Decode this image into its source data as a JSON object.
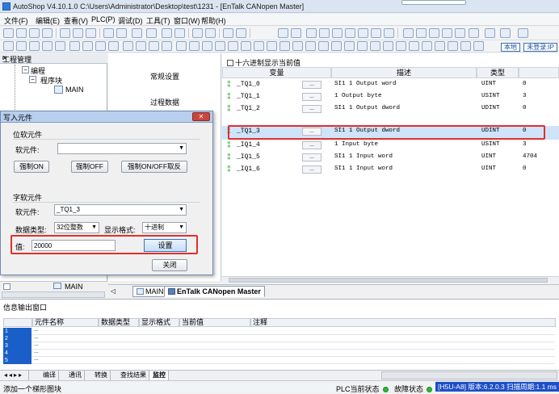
{
  "window": {
    "title": "AutoShop V4.10.1.0  C:\\Users\\Administrator\\Desktop\\test\\1231 - [EnTalk CANopen Master]"
  },
  "menu": [
    "文件(F)",
    "编辑(E)",
    "查看(V)",
    "PLC(P)",
    "调试(D)",
    "工具(T)",
    "窗口(W)",
    "帮助(H)"
  ],
  "toolbar": {
    "local_label": "本地",
    "login_label": "未登录:IP"
  },
  "project_panel": {
    "title": "工程管理",
    "tree": [
      {
        "label": "编程"
      },
      {
        "label": "程序块"
      },
      {
        "label": "MAIN"
      }
    ],
    "bottom_item": "MAIN"
  },
  "middle_column": {
    "items": [
      "常规设置",
      "过程数据"
    ]
  },
  "variable_table": {
    "hex_checkbox_label": "十六进制显示当前值",
    "headers": {
      "var": "变量",
      "desc": "描述",
      "type": "类型",
      "val": ""
    },
    "rows": [
      {
        "var": "_TQ1_0",
        "dots": "...",
        "desc": "SI1 1 Output word",
        "type": "UINT",
        "val": "0"
      },
      {
        "var": "_TQ1_1",
        "dots": "...",
        "desc": "1 Output byte",
        "type": "USINT",
        "val": "3"
      },
      {
        "var": "_TQ1_2",
        "dots": "...",
        "desc": "SI1 1 Output dword",
        "type": "UDINT",
        "val": "0"
      },
      {
        "var": "_TQ1_3",
        "dots": "...",
        "desc": "SI1 1 Output dword",
        "type": "UDINT",
        "val": "0"
      },
      {
        "var": "_IQ1_4",
        "dots": "...",
        "desc": "1 Input byte",
        "type": "USINT",
        "val": "3"
      },
      {
        "var": "_IQ1_5",
        "dots": "...",
        "desc": "SI1 1 Input word",
        "type": "UINT",
        "val": "4704"
      },
      {
        "var": "_IQ1_6",
        "dots": "...",
        "desc": "SI1 1 Input word",
        "type": "UINT",
        "val": "0"
      }
    ]
  },
  "doc_tabs": [
    "MAIN",
    "EnTalk CANopen Master"
  ],
  "dialog": {
    "title": "写入元件",
    "close_label": "✕",
    "bit_group_title": "位软元件",
    "bit_label": "软元件:",
    "bit_buttons": [
      "强制ON",
      "强制OFF",
      "强制ON/OFF取反"
    ],
    "word_group_title": "字软元件",
    "word_label": "软元件:",
    "word_value": "_TQ1_3",
    "datatype_label": "数据类型:",
    "datatype_value": "32位整数",
    "format_label": "显示格式:",
    "format_value": "十进制",
    "value_label": "值:",
    "value": "20000",
    "set_label": "设置",
    "close_button_label": "关闭"
  },
  "info_panel": {
    "title": "信息输出窗口",
    "headers": [
      "元件名称",
      "数据类型",
      "显示格式",
      "当前值",
      "注释"
    ],
    "row_numbers": [
      "1",
      "2",
      "3",
      "4",
      "5"
    ],
    "row_first": "...",
    "tabs": [
      "编译",
      "通讯",
      "转换",
      "查找结果",
      "监控"
    ]
  },
  "status": {
    "left": "添加一个梯形图块",
    "plc_state_label": "PLC当前状态",
    "fault_label": "故障状态",
    "version": "[H5U-A8] 版本:6.2.0.3 扫描周期:1.1 ms"
  },
  "colors": {
    "selection_outline": "#e0302a",
    "selected_row": "#cfe3fb",
    "version_badge": "#1e4fc7"
  }
}
